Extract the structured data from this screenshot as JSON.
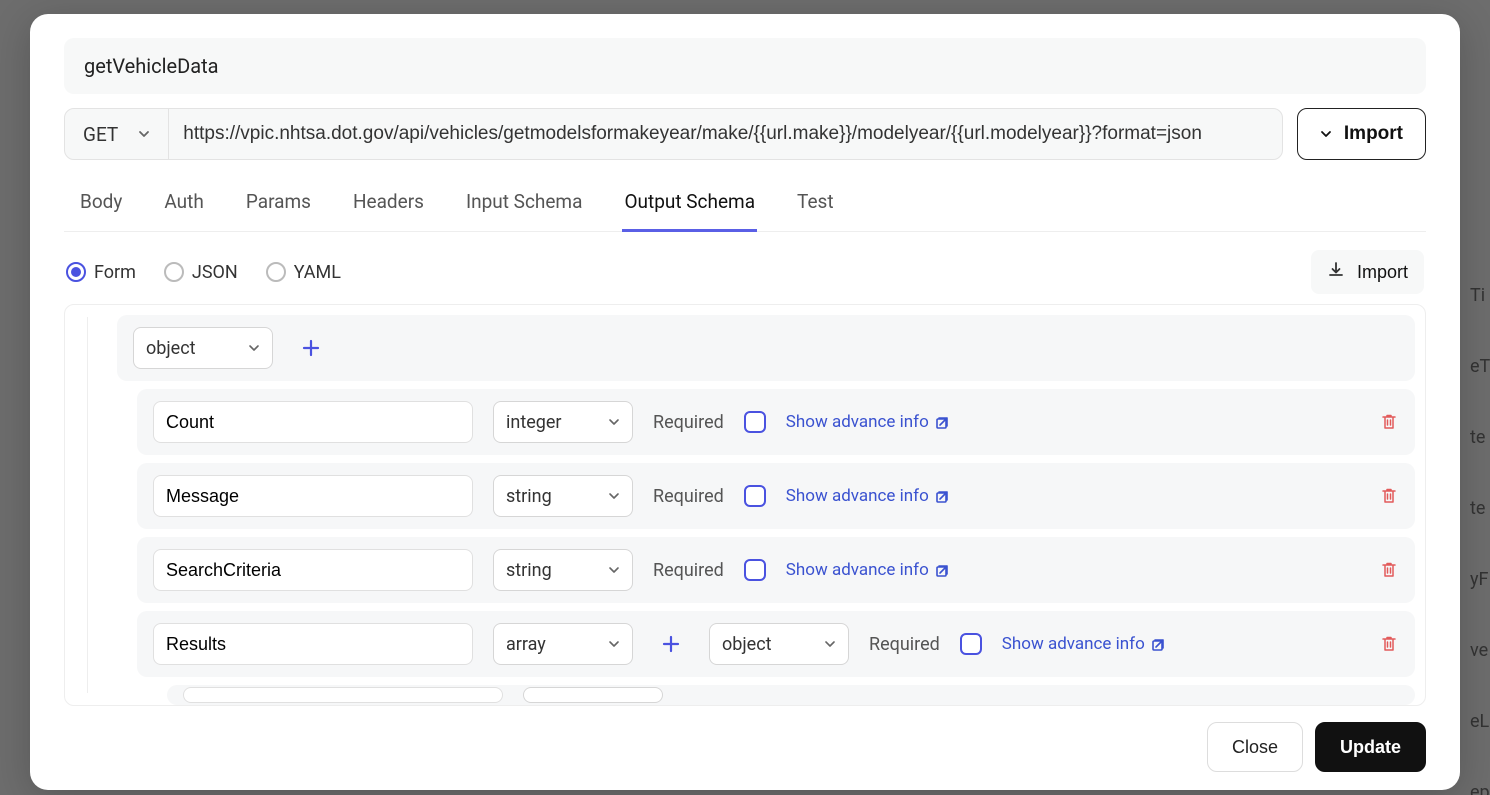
{
  "modal": {
    "name": "getVehicleData",
    "method": "GET",
    "url": "https://vpic.nhtsa.dot.gov/api/vehicles/getmodelsformakeyear/make/{{url.make}}/modelyear/{{url.modelyear}}?format=json",
    "import_label": "Import"
  },
  "tabs": [
    "Body",
    "Auth",
    "Params",
    "Headers",
    "Input Schema",
    "Output Schema",
    "Test"
  ],
  "active_tab": "Output Schema",
  "formats": [
    "Form",
    "JSON",
    "YAML"
  ],
  "active_format": "Form",
  "side_import_label": "Import",
  "schema": {
    "root_type": "object",
    "fields": [
      {
        "name": "Count",
        "type": "integer",
        "required_label": "Required",
        "advance_label": "Show advance info"
      },
      {
        "name": "Message",
        "type": "string",
        "required_label": "Required",
        "advance_label": "Show advance info"
      },
      {
        "name": "SearchCriteria",
        "type": "string",
        "required_label": "Required",
        "advance_label": "Show advance info"
      },
      {
        "name": "Results",
        "type": "array",
        "item_type": "object",
        "required_label": "Required",
        "advance_label": "Show advance info"
      }
    ]
  },
  "footer": {
    "close_label": "Close",
    "update_label": "Update"
  },
  "background_hints": [
    "Ti",
    "eT",
    "te",
    "te",
    "yF",
    "ve",
    "eL",
    "ep"
  ]
}
